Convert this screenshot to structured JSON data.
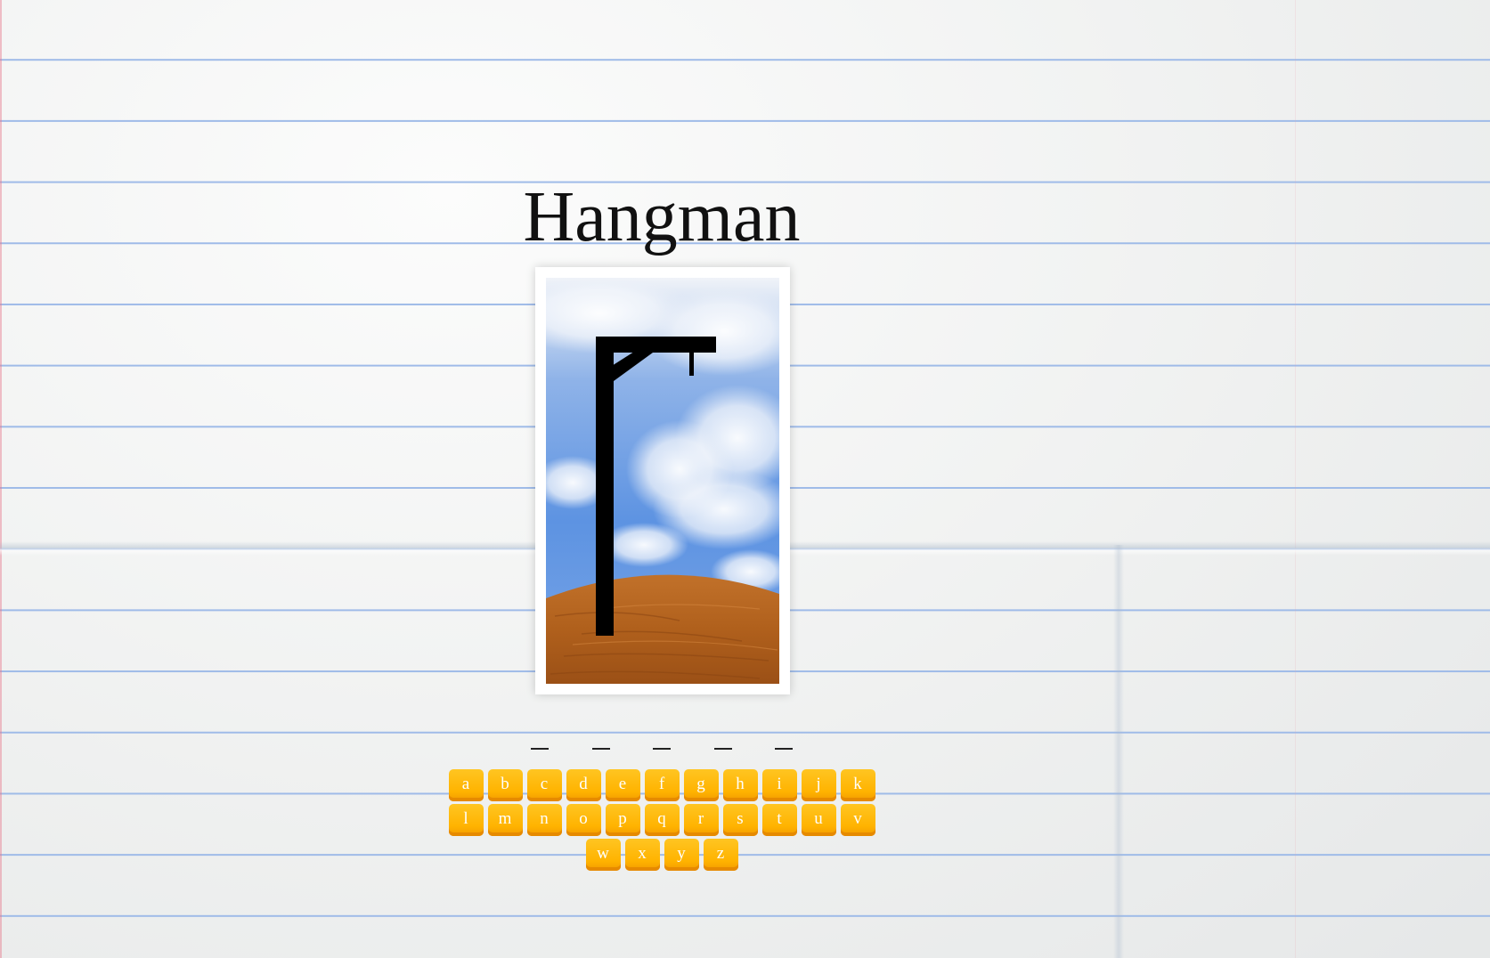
{
  "game": {
    "title": "Hangman"
  },
  "word": {
    "slots": [
      "_",
      "_",
      "_",
      "_",
      "_"
    ]
  },
  "keyboard": {
    "rows": [
      [
        "a",
        "b",
        "c",
        "d",
        "e",
        "f",
        "g",
        "h",
        "i",
        "j",
        "k"
      ],
      [
        "l",
        "m",
        "n",
        "o",
        "p",
        "q",
        "r",
        "s",
        "t",
        "u",
        "v"
      ],
      [
        "w",
        "x",
        "y",
        "z"
      ]
    ]
  },
  "colors": {
    "key_fill": "#ffb300",
    "key_text": "#ffffff",
    "sky": "#5d93e2",
    "ground": "#b5651d",
    "gallows": "#000000"
  },
  "icons": {
    "scene": "gallows-scene-icon"
  }
}
